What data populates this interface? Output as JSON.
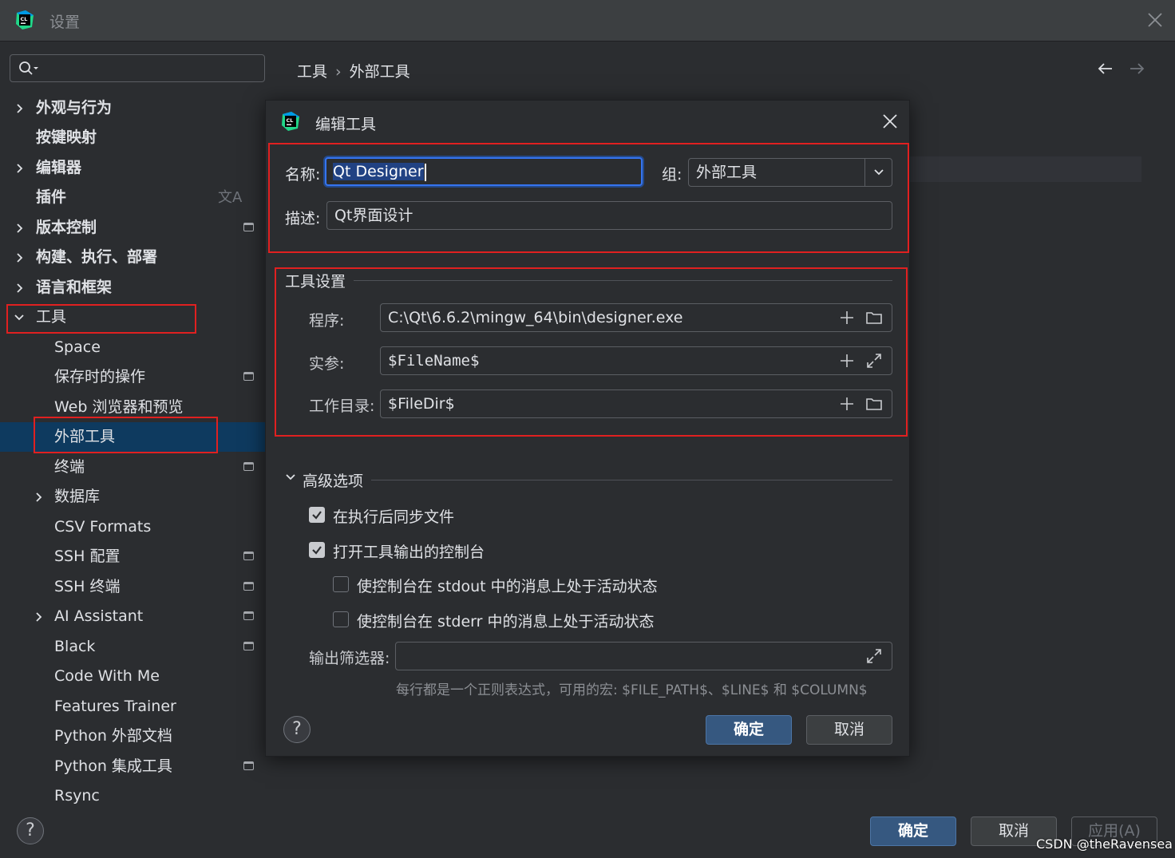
{
  "window": {
    "title": "设置",
    "logo_text": "CL"
  },
  "search": {
    "placeholder": ""
  },
  "sidebar": {
    "items": [
      {
        "label": "外观与行为",
        "expandable": true
      },
      {
        "label": "按键映射"
      },
      {
        "label": "编辑器",
        "expandable": true
      },
      {
        "label": "插件",
        "icon": "文A"
      },
      {
        "label": "版本控制",
        "expandable": true
      },
      {
        "label": "构建、执行、部署",
        "expandable": true
      },
      {
        "label": "语言和框架",
        "expandable": true
      },
      {
        "label": "工具",
        "expanded": true
      },
      {
        "label": "Space"
      },
      {
        "label": "保存时的操作"
      },
      {
        "label": "Web 浏览器和预览"
      },
      {
        "label": "外部工具",
        "selected": true
      },
      {
        "label": "终端"
      },
      {
        "label": "数据库",
        "expandable": true
      },
      {
        "label": "CSV Formats"
      },
      {
        "label": "SSH 配置"
      },
      {
        "label": "SSH 终端"
      },
      {
        "label": "AI Assistant",
        "expandable": true
      },
      {
        "label": "Black"
      },
      {
        "label": "Code With Me"
      },
      {
        "label": "Features Trainer"
      },
      {
        "label": "Python 外部文档"
      },
      {
        "label": "Python 集成工具"
      },
      {
        "label": "Rsync"
      }
    ]
  },
  "breadcrumb": {
    "parent": "工具",
    "separator": "›",
    "current": "外部工具"
  },
  "dialog": {
    "title": "编辑工具",
    "name_label": "名称:",
    "name_value": "Qt Designer",
    "group_label": "组:",
    "group_value": "外部工具",
    "desc_label": "描述:",
    "desc_value": "Qt界面设计",
    "tool_settings": {
      "title": "工具设置",
      "program_label": "程序:",
      "program_value": "C:\\Qt\\6.6.2\\mingw_64\\bin\\designer.exe",
      "args_label": "实参:",
      "args_value": "$FileName$",
      "workdir_label": "工作目录:",
      "workdir_value": "$FileDir$"
    },
    "advanced": {
      "title": "高级选项",
      "sync_files": {
        "label": "在执行后同步文件",
        "checked": true
      },
      "open_console": {
        "label": "打开工具输出的控制台",
        "checked": true
      },
      "stdout_active": {
        "label": "使控制台在 stdout 中的消息上处于活动状态",
        "checked": false
      },
      "stderr_active": {
        "label": "使控制台在 stderr 中的消息上处于活动状态",
        "checked": false
      },
      "output_filter_label": "输出筛选器:",
      "output_filter_value": "",
      "hint": "每行都是一个正则表达式，可用的宏: $FILE_PATH$、$LINE$ 和 $COLUMN$"
    },
    "ok_label": "确定",
    "cancel_label": "取消",
    "help_label": "?"
  },
  "footer": {
    "ok_label": "确定",
    "cancel_label": "取消",
    "apply_label": "应用(A)",
    "help_label": "?"
  },
  "watermark": "CSDN @theRavensea",
  "colors": {
    "background": "#2b2d30",
    "selection": "#0e3a5f",
    "primary_button": "#365880",
    "focus_border": "#3574f0",
    "annotation_red": "#e02020"
  }
}
